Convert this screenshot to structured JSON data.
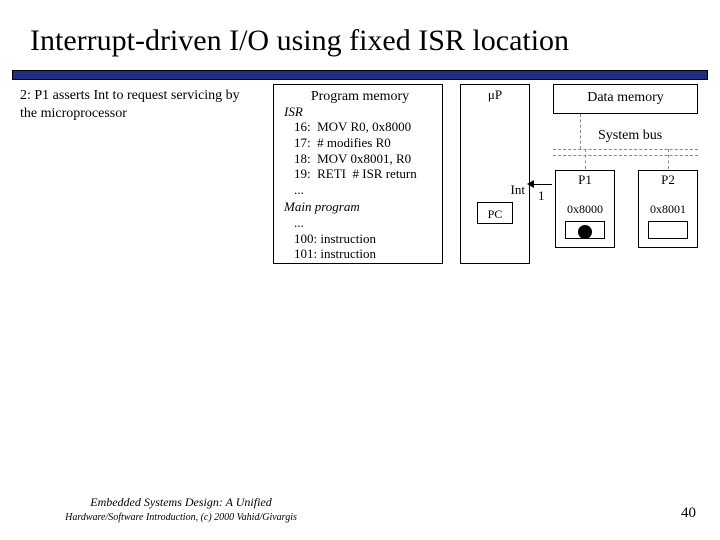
{
  "title": "Interrupt-driven I/O using fixed ISR location",
  "step_text": "2: P1 asserts Int to request servicing by the microprocessor",
  "program_memory": {
    "title": "Program memory",
    "isr_label": "ISR",
    "line16": "16:  MOV R0, 0x8000",
    "line17": "17:  # modifies R0",
    "line18": "18:  MOV 0x8001, R0",
    "line19": "19:  RETI  # ISR return",
    "dots1": "...",
    "main_label": "Main program",
    "dots2": "...",
    "line100": "100: instruction",
    "line101": "101: instruction"
  },
  "cpu": {
    "label": "μP",
    "int_label": "Int",
    "pc_label": "PC"
  },
  "data_memory": "Data memory",
  "system_bus": "System bus",
  "p1": {
    "label": "P1",
    "addr": "0x8000"
  },
  "p2": {
    "label": "P2",
    "addr": "0x8001"
  },
  "int_value": "1",
  "footer": {
    "line1": "Embedded Systems Design: A Unified",
    "line2": "Hardware/Software Introduction, (c) 2000 Vahid/Givargis"
  },
  "page_number": "40"
}
